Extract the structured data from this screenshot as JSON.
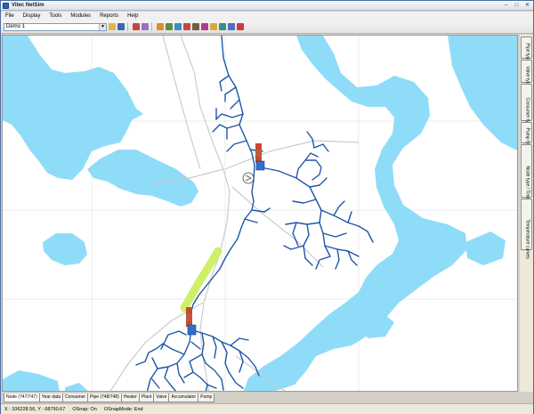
{
  "window": {
    "title": "Vitec NetSim"
  },
  "menu": [
    "File",
    "Display",
    "Tools",
    "Modules",
    "Reports",
    "Help"
  ],
  "toolbar": {
    "project": "Demo 1"
  },
  "right_tabs": [
    "Pipe type",
    "Valve type",
    "Consumer type",
    "Pump type",
    "Node type / Time series",
    "Temperature curves"
  ],
  "bottom_tabs": [
    "Node (747/747)",
    "Year data",
    "Consumer",
    "Pipe (748/748)",
    "Heater",
    "Plant",
    "Valve",
    "Accumulator",
    "Pump"
  ],
  "status": {
    "coords": "X : 106228.56, Y : 68790.67",
    "osnap": "OSnap: On",
    "osnap_mode": "OSnapMode: End"
  },
  "colors": {
    "water": "#8fdcf8",
    "pipe": "#1f56a8",
    "highlight": "#cfef6a",
    "road": "#c8ccd0"
  },
  "icons": [
    "application-icon",
    "open-folder-icon",
    "save-icon",
    "measure-icon",
    "zoom-icon",
    "pan-icon",
    "layer-icon",
    "node-icon",
    "pipe-icon",
    "heater-icon",
    "pump-icon",
    "valve-icon",
    "delete-icon"
  ]
}
